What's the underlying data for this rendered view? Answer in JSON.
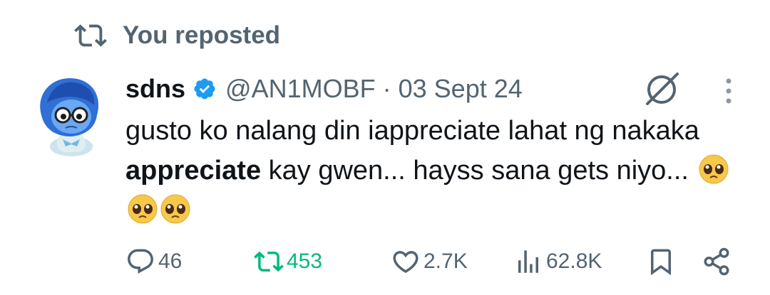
{
  "social_context": {
    "text": "You reposted",
    "icon": "repost-icon"
  },
  "tweet": {
    "author": {
      "display_name": "sdns",
      "handle": "@AN1MOBF",
      "verified": true,
      "avatar": "blue-character-avatar"
    },
    "separator": "·",
    "date": "03 Sept 24",
    "text_part1": "gusto ko nalang din iappreciate lahat ng nakaka ",
    "text_bold": "appreciate",
    "text_part2": " kay gwen... hayss sana gets niyo...",
    "emojis": [
      "pleading-face",
      "pleading-face",
      "pleading-face"
    ]
  },
  "actions": {
    "replies": "46",
    "reposts": "453",
    "likes": "2.7K",
    "views": "62.8K"
  },
  "colors": {
    "secondary_text": "#536471",
    "repost_active": "#00ba7c",
    "verified_blue": "#1d9bf0",
    "primary_text": "#0f1419"
  }
}
